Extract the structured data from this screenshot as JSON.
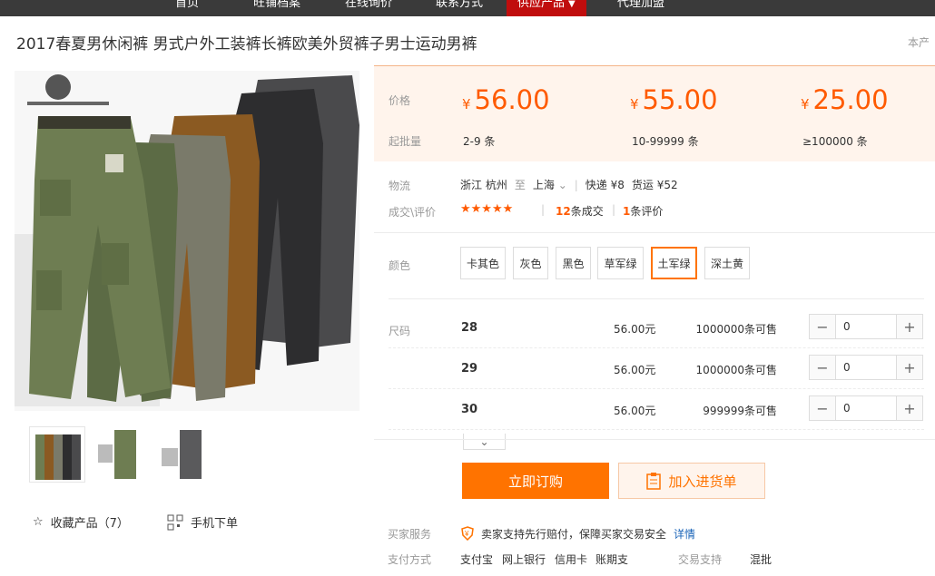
{
  "nav": {
    "items": [
      "首页",
      "旺铺档案",
      "在线询价",
      "联系方式",
      "供应产品",
      "代理加盟"
    ],
    "active_index": 4,
    "active_caret": "▼"
  },
  "product": {
    "title": "2017春夏男休闲裤 男式户外工装裤长裤欧美外贸裤子男士运动男裤",
    "side_note": "本产"
  },
  "image": {
    "actions": {
      "favorite": "收藏产品（7）",
      "mobile": "手机下单"
    }
  },
  "price": {
    "price_label": "价格",
    "moq_label": "起批量",
    "currency": "¥",
    "tiers": [
      {
        "price": "56.00",
        "moq": "2-9 条"
      },
      {
        "price": "55.00",
        "moq": "10-99999 条"
      },
      {
        "price": "25.00",
        "moq": "≥100000 条"
      }
    ]
  },
  "logistics": {
    "label": "物流",
    "from": "浙江 杭州",
    "to_word": "至",
    "dest": "上海",
    "express": "快递 ¥8",
    "freight": "货运 ¥52"
  },
  "deals": {
    "label": "成交\\评价",
    "stars": "★★★★★",
    "deal_count": "12",
    "deal_suffix": "条成交",
    "review_count": "1",
    "review_suffix": "条评价"
  },
  "colors": {
    "label": "颜色",
    "options": [
      "卡其色",
      "灰色",
      "黑色",
      "草军绿",
      "土军绿",
      "深土黄"
    ],
    "selected_index": 4
  },
  "sizes": {
    "label": "尺码",
    "rows": [
      {
        "size": "28",
        "price": "56.00元",
        "stock": "1000000条可售",
        "qty": "0"
      },
      {
        "size": "29",
        "price": "56.00元",
        "stock": "1000000条可售",
        "qty": "0"
      },
      {
        "size": "30",
        "price": "56.00元",
        "stock": "999999条可售",
        "qty": "0"
      }
    ]
  },
  "buttons": {
    "order": "立即订购",
    "cart": "加入进货单"
  },
  "service": {
    "label": "买家服务",
    "text": "卖家支持先行赔付，保障买家交易安全",
    "detail": "详情"
  },
  "payment": {
    "label": "支付方式",
    "methods": [
      "支付宝",
      "网上银行",
      "信用卡",
      "账期支"
    ],
    "trade_label": "交易支持",
    "trade_value": "混批"
  },
  "colors_theme": {
    "accent": "#ff7300",
    "price": "#ff5a00",
    "nav_active": "#c00d0d"
  }
}
